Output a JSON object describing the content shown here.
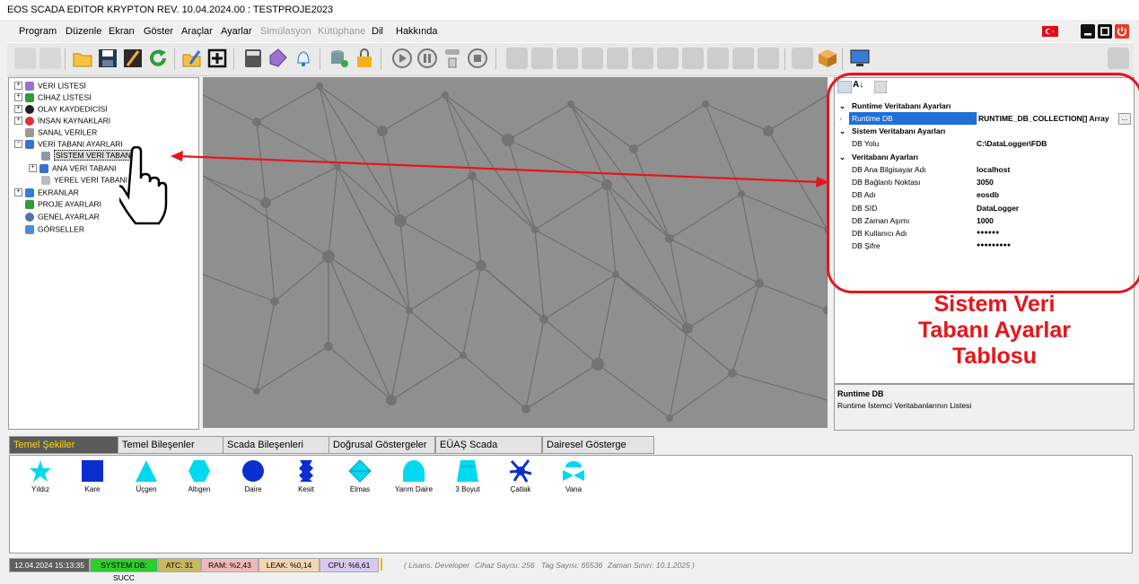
{
  "window": {
    "title": "EOS SCADA EDITOR KRYPTON REV. 10.04.2024.00 : TESTPROJE2023"
  },
  "menu": [
    {
      "label": "Program",
      "enabled": true
    },
    {
      "label": "Düzenle",
      "enabled": true
    },
    {
      "label": "Ekran",
      "enabled": true
    },
    {
      "label": "Göster",
      "enabled": true
    },
    {
      "label": "Araçlar",
      "enabled": true
    },
    {
      "label": "Ayarlar",
      "enabled": true
    },
    {
      "label": "Simülasyon",
      "enabled": false
    },
    {
      "label": "Kütüphane",
      "enabled": false
    },
    {
      "label": "Dil",
      "enabled": true
    },
    {
      "label": "Hakkında",
      "enabled": true
    }
  ],
  "tree": {
    "items": [
      {
        "label": "VERİ LİSTESİ",
        "icon": "tag-icon",
        "expander": "+"
      },
      {
        "label": "CİHAZ LİSTESİ",
        "icon": "device-icon",
        "expander": "+"
      },
      {
        "label": "OLAY KAYDEDİCİSİ",
        "icon": "alarm-bell-icon",
        "expander": "+"
      },
      {
        "label": "İNSAN KAYNAKLARI",
        "icon": "user-icon",
        "expander": "+"
      },
      {
        "label": "SANAL VERİLER",
        "icon": "virtual-data-icon",
        "expander": ""
      },
      {
        "label": "VERİ TABANI AYARLARI",
        "icon": "database-icon",
        "expander": "−"
      },
      {
        "label": "SİSTEM VERİ TABANI",
        "icon": "database-icon",
        "expander": "",
        "selected": true
      },
      {
        "label": "ANA VERİ TABANI",
        "icon": "database-icon",
        "expander": "+"
      },
      {
        "label": "YEREL VERİ TABANI",
        "icon": "database-icon",
        "expander": ""
      },
      {
        "label": "EKRANLAR",
        "icon": "monitor-icon",
        "expander": "+"
      },
      {
        "label": "PROJE AYARLARI",
        "icon": "project-icon",
        "expander": ""
      },
      {
        "label": "GENEL AYARLAR",
        "icon": "gear-icon",
        "expander": ""
      },
      {
        "label": "GÖRSELLER",
        "icon": "image-icon",
        "expander": ""
      }
    ]
  },
  "properties": {
    "sections": {
      "runtime": "Runtime Veritabanı Ayarları",
      "system": "Sistem Veritabanı Ayarları",
      "db": "Veritabanı Ayarları"
    },
    "rows": {
      "runtime_db": {
        "name": "Runtime DB",
        "value": "RUNTIME_DB_COLLECTION[] Array"
      },
      "db_path": {
        "name": "DB Yolu",
        "value": "C:\\DataLogger\\FDB"
      },
      "db_host": {
        "name": "DB Ana Bilgisayar Adı",
        "value": "localhost"
      },
      "db_port": {
        "name": "DB Bağlantı Noktası",
        "value": "3050"
      },
      "db_name": {
        "name": "DB Adı",
        "value": "eosdb"
      },
      "db_sid": {
        "name": "DB SID",
        "value": "DataLogger"
      },
      "db_timeout": {
        "name": "DB Zaman Aşımı",
        "value": "1000"
      },
      "db_user": {
        "name": "DB Kullanıcı Adı",
        "value": "●●●●●●"
      },
      "db_pass": {
        "name": "DB Şifre",
        "value": "●●●●●●●●●"
      }
    },
    "ellipsis": "...",
    "description_title": "Runtime DB",
    "description_text": "Runtime İstemci Veritabanlarının Listesi"
  },
  "callout": {
    "lines": [
      "Sistem Veri",
      "Tabanı Ayarlar",
      "Tablosu"
    ],
    "color": "#e8141a"
  },
  "tabs": [
    {
      "label": "Temel Şekiller",
      "active": true
    },
    {
      "label": "Temel Bileşenler"
    },
    {
      "label": "Scada Bileşenleri"
    },
    {
      "label": "Doğrusal Göstergeler"
    },
    {
      "label": "EÜAŞ Scada"
    },
    {
      "label": "Dairesel Gösterge"
    }
  ],
  "shapes": [
    {
      "label": "Yıldız",
      "icon": "star-icon"
    },
    {
      "label": "Kare",
      "icon": "square-icon"
    },
    {
      "label": "Üçgen",
      "icon": "triangle-icon"
    },
    {
      "label": "Altıgen",
      "icon": "hexagon-icon"
    },
    {
      "label": "Daire",
      "icon": "circle-icon"
    },
    {
      "label": "Kesit",
      "icon": "section-icon"
    },
    {
      "label": "Elmas",
      "icon": "diamond-icon"
    },
    {
      "label": "Yarım Daire",
      "icon": "half-circle-icon"
    },
    {
      "label": "3 Boyut",
      "icon": "3d-icon"
    },
    {
      "label": "Çatlak",
      "icon": "crack-icon"
    },
    {
      "label": "Vana",
      "icon": "valve-icon"
    }
  ],
  "status": {
    "datetime": "12.04.2024 15:13:35",
    "system_db": "SYSTEM DB: SUCC",
    "atc": "ATC: 31",
    "ram": "RAM: %2,43",
    "leak": "LEAK: %0,14",
    "cpu": "CPU: %6,61",
    "license": "( Lisans: Developer",
    "device_count": "Cihaz Sayısı: 256",
    "tag_count": "Tag Sayısı: 65536",
    "time_limit": "Zaman Sınırı: 10.1.2025 )"
  },
  "colors": {
    "accent_red": "#e8141a",
    "shape_cyan": "#00d9f0",
    "shape_blue": "#0b2fcf",
    "selection_blue": "#1f6fd6"
  }
}
